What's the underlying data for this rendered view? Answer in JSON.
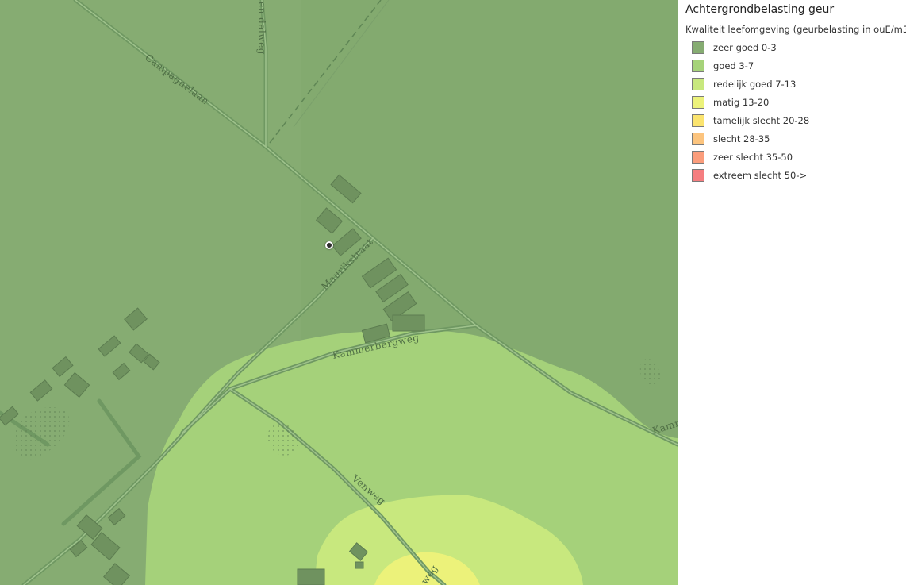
{
  "legend": {
    "title": "Achtergrondbelasting geur",
    "subtitle": "Kwaliteit leefomgeving (geurbelasting in ouE/m3)",
    "items": [
      {
        "label": "zeer goed 0-3",
        "color": "#86ac72"
      },
      {
        "label": "goed 3-7",
        "color": "#a6d37a"
      },
      {
        "label": "redelijk goed 7-13",
        "color": "#c8e87e"
      },
      {
        "label": "matig 13-20",
        "color": "#ecf27a"
      },
      {
        "label": "tamelijk slecht 20-28",
        "color": "#fbe46f"
      },
      {
        "label": "slecht 28-35",
        "color": "#fcc47e"
      },
      {
        "label": "zeer slecht 35-50",
        "color": "#fb9d7c"
      },
      {
        "label": "extreem slecht 50->",
        "color": "#f57e80"
      }
    ]
  },
  "map": {
    "streets": {
      "campagnelaan": "Campagnelaan",
      "en_dalweg": "en dalweg",
      "maurikstraat": "Maurikstraat",
      "kammerbergweg": "Kammerbergweg",
      "kamm": "Kamm",
      "venweg": "Venweg",
      "weg_fragment": "weg"
    }
  }
}
